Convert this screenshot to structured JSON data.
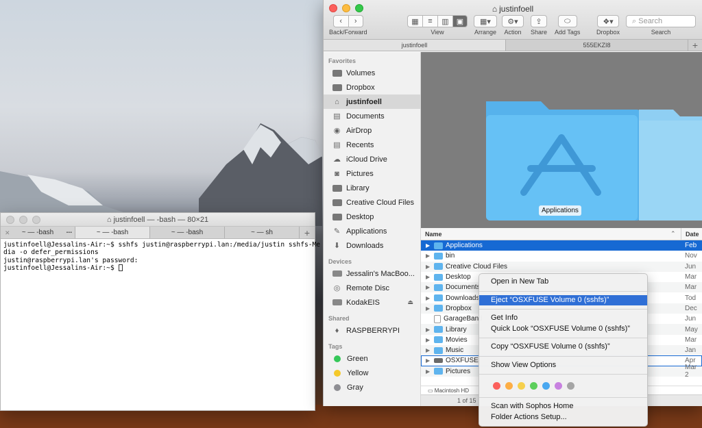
{
  "colors": {
    "selection_blue": "#1669d3",
    "menu_highlight": "#2f6fd6",
    "folder_blue": "#5fb4ee"
  },
  "terminal": {
    "title": "justinfoell — -bash — 80×21",
    "tabs": [
      {
        "label": "-bash",
        "prefix": "~ —",
        "extra": "...",
        "active": false
      },
      {
        "label": "-bash",
        "prefix": "~ —",
        "active": true
      },
      {
        "label": "-bash",
        "prefix": "~ —",
        "active": false
      },
      {
        "label": "sh",
        "prefix": "~ —",
        "active": false
      }
    ],
    "add_tab": "+",
    "lines": [
      "justinfoell@Jessalins-Air:~$ sshfs justin@raspberrypi.lan:/media/justin sshfs-Me",
      "dia -o defer_permissions",
      "justin@raspberrypi.lan's password:",
      "justinfoell@Jessalins-Air:~$ "
    ]
  },
  "finder": {
    "title": "justinfoell",
    "toolbar": {
      "back_forward": "Back/Forward",
      "view": "View",
      "arrange": "Arrange",
      "action": "Action",
      "share": "Share",
      "add_tags": "Add Tags",
      "dropbox": "Dropbox",
      "search_label": "Search",
      "search_placeholder": "Search"
    },
    "tabs": [
      "justinfoell",
      "555EKZI8"
    ],
    "add_tab": "+",
    "sidebar": {
      "favorites_header": "Favorites",
      "favorites": [
        {
          "label": "Volumes",
          "icon": "folder-icon"
        },
        {
          "label": "Dropbox",
          "icon": "folder-icon"
        },
        {
          "label": "justinfoell",
          "icon": "home-icon",
          "selected": true
        },
        {
          "label": "Documents",
          "icon": "documents-icon"
        },
        {
          "label": "AirDrop",
          "icon": "airdrop-icon"
        },
        {
          "label": "Recents",
          "icon": "recents-icon"
        },
        {
          "label": "iCloud Drive",
          "icon": "cloud-icon"
        },
        {
          "label": "Pictures",
          "icon": "camera-icon"
        },
        {
          "label": "Library",
          "icon": "folder-icon"
        },
        {
          "label": "Creative Cloud Files",
          "icon": "folder-icon"
        },
        {
          "label": "Desktop",
          "icon": "folder-icon"
        },
        {
          "label": "Applications",
          "icon": "applications-icon"
        },
        {
          "label": "Downloads",
          "icon": "downloads-icon"
        }
      ],
      "devices_header": "Devices",
      "devices": [
        {
          "label": "Jessalin's MacBoo...",
          "icon": "laptop-icon"
        },
        {
          "label": "Remote Disc",
          "icon": "disc-icon"
        },
        {
          "label": "KodakEIS",
          "icon": "drive-icon",
          "eject": "⏏"
        }
      ],
      "shared_header": "Shared",
      "shared": [
        {
          "label": "RASPBERRYPI",
          "icon": "network-icon"
        }
      ],
      "tags_header": "Tags",
      "tags": [
        {
          "label": "Green",
          "color": "#35c759"
        },
        {
          "label": "Yellow",
          "color": "#f5c92a"
        },
        {
          "label": "Gray",
          "color": "#8e8e93"
        }
      ]
    },
    "preview_label": "Applications",
    "list": {
      "col_name": "Name",
      "col_date": "Date",
      "rows": [
        {
          "name": "Applications",
          "date": "Feb",
          "icon": "folder",
          "selected": true
        },
        {
          "name": "bin",
          "date": "Nov",
          "icon": "folder"
        },
        {
          "name": "Creative Cloud Files",
          "date": "Jun",
          "icon": "folder"
        },
        {
          "name": "Desktop",
          "date": "Mar",
          "icon": "folder"
        },
        {
          "name": "Documents",
          "date": "Mar",
          "icon": "folder"
        },
        {
          "name": "Downloads",
          "date": "Tod",
          "icon": "folder"
        },
        {
          "name": "Dropbox",
          "date": "Dec",
          "icon": "folder"
        },
        {
          "name": "GarageBand",
          "date": "Jun",
          "icon": "plain",
          "no_triangle": true
        },
        {
          "name": "Library",
          "date": "May",
          "icon": "folder"
        },
        {
          "name": "Movies",
          "date": "Mar",
          "icon": "folder"
        },
        {
          "name": "Music",
          "date": "Jan",
          "icon": "folder"
        },
        {
          "name": "OSXFUSE",
          "date": "Apr",
          "icon": "drive",
          "outlined": true
        },
        {
          "name": "Pictures",
          "date": "Mar 2",
          "icon": "folder"
        }
      ]
    },
    "pathbar": "Macintosh HD",
    "status": "1 of 15"
  },
  "context_menu": {
    "items_group1": [
      "Open in New Tab"
    ],
    "highlighted": "Eject “OSXFUSE Volume 0 (sshfs)”",
    "items_group2": [
      "Get Info",
      "Quick Look “OSXFUSE Volume 0 (sshfs)”"
    ],
    "items_group3": [
      "Copy “OSXFUSE Volume 0 (sshfs)”"
    ],
    "items_group4": [
      "Show View Options"
    ],
    "tag_colors": [
      "#fc605c",
      "#fdae45",
      "#f6d04d",
      "#5ccf5b",
      "#4aa8f0",
      "#c881e0",
      "#a5a5a5"
    ],
    "items_group5": [
      "Scan with Sophos Home",
      "Folder Actions Setup..."
    ]
  }
}
